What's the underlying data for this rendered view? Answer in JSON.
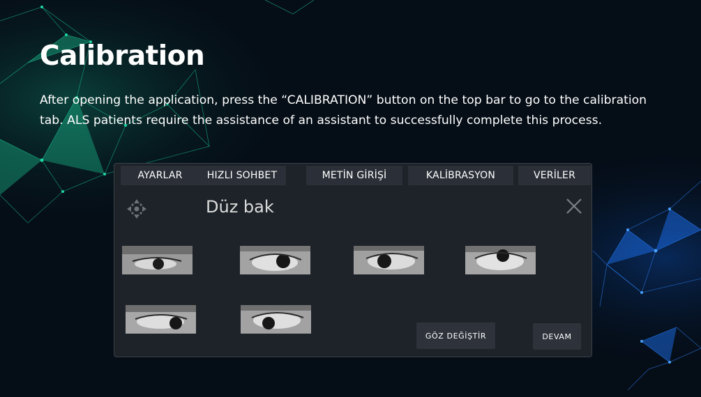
{
  "slide": {
    "title": "Calibration",
    "description": "After opening the application, press the “CALIBRATION” button on the top bar to go to the calibration tab. ALS patients require the assistance of an assistant to successfully complete this process."
  },
  "app": {
    "tabs": [
      {
        "label": "AYARLAR"
      },
      {
        "label": "HIZLI SOHBET"
      },
      {
        "label": "METİN GİRİŞİ"
      },
      {
        "label": "KALİBRASYON"
      },
      {
        "label": "VERİLER"
      }
    ],
    "panel_title": "Düz bak",
    "eye_samples": [
      {
        "icon": "eye-sample-1"
      },
      {
        "icon": "eye-sample-2"
      },
      {
        "icon": "eye-sample-3"
      },
      {
        "icon": "eye-sample-4"
      },
      {
        "icon": "eye-sample-5"
      },
      {
        "icon": "eye-sample-6"
      }
    ],
    "buttons": {
      "switch_eye": "GÖZ DEĞİŞTİR",
      "continue": "DEVAM"
    }
  },
  "colors": {
    "background": "#050d16",
    "panel": "#1e2329",
    "tab": "#2b3038",
    "network_green": "#1fd6a0",
    "network_blue": "#1e78ff"
  }
}
